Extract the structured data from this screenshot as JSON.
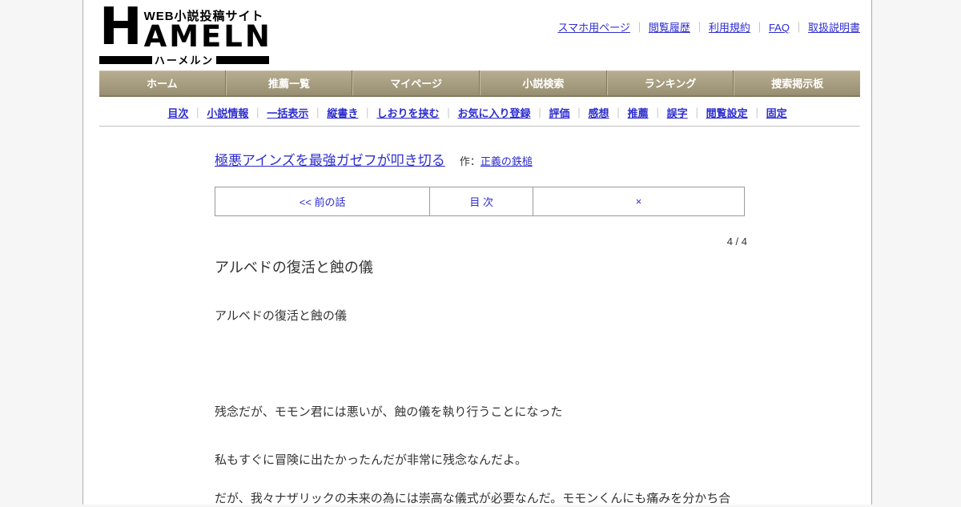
{
  "colors": {
    "page_bg": "#f6f6f6",
    "content_bg": "#ffffff",
    "nav_tan_top": "#b8ae91",
    "nav_tan_bottom": "#988e71",
    "link_blue": "#2d2dcf",
    "text": "#333333",
    "separator_gray": "#999999"
  },
  "ui": {
    "separator": "｜"
  },
  "logo": {
    "h": "H",
    "tagline": "WEB小説投稿サイト",
    "rest": "AMELN",
    "kana": "ハーメルン"
  },
  "header_links": {
    "smartphone": "スマホ用ページ",
    "history": "閲覧履歴",
    "terms": "利用規約",
    "faq": "FAQ",
    "manual": "取扱説明書"
  },
  "nav": {
    "home": "ホーム",
    "recommend_list": "推薦一覧",
    "mypage": "マイページ",
    "novel_search": "小説検索",
    "ranking": "ランキング",
    "search_board": "捜索掲示板"
  },
  "subnav": {
    "toc": "目次",
    "novel_info": "小説情報",
    "batch_view": "一括表示",
    "vertical": "縦書き",
    "bookmark": "しおりを挟む",
    "favorite": "お気に入り登録",
    "rate": "評価",
    "comments": "感想",
    "recommend": "推薦",
    "typo": "誤字",
    "view_settings": "閲覧設定",
    "fixed": "固定"
  },
  "novel": {
    "title": "極悪アインズを最強ガゼフが叩き切る",
    "author_prefix": "作：",
    "author": "正義の鉄槌",
    "pager": {
      "prev": "<< 前の話",
      "index": "目 次",
      "next": "×"
    },
    "page_indicator": "4 / 4",
    "episode_title": "アルベドの復活と蝕の儀",
    "paragraphs": {
      "p1": "アルベドの復活と蝕の儀",
      "p2": "残念だが、モモン君には悪いが、蝕の儀を執り行うことになった",
      "p3": "私もすぐに冒険に出たかったんだが非常に残念なんだよ。",
      "p4": "だが、我々ナザリックの未来の為には崇高な儀式が必要なんだ。モモンくんにも痛みを分かち合"
    }
  }
}
